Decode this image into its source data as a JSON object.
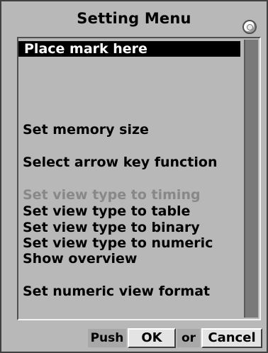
{
  "window": {
    "title": "Setting Menu"
  },
  "list": {
    "items": [
      {
        "label": "Place mark here",
        "state": "selected"
      },
      {
        "label": "Set memory size",
        "state": "normal"
      },
      {
        "label": "Select arrow key function",
        "state": "normal"
      },
      {
        "label": "Set view type to timing",
        "state": "disabled"
      },
      {
        "label": "Set view type to table",
        "state": "normal"
      },
      {
        "label": "Set view type to binary",
        "state": "normal"
      },
      {
        "label": "Set view type to numeric",
        "state": "normal"
      },
      {
        "label": "Show overview",
        "state": "normal"
      },
      {
        "label": "Set numeric view format",
        "state": "normal"
      }
    ]
  },
  "footer": {
    "push_label": "Push",
    "ok_label": "OK",
    "or_label": "or",
    "cancel_label": "Cancel"
  },
  "colors": {
    "window_bg": "#b8b8b8",
    "selection_bg": "#000000",
    "selection_fg": "#ffffff",
    "disabled_text": "#888888",
    "scrollbar": "#7a7a7a"
  }
}
